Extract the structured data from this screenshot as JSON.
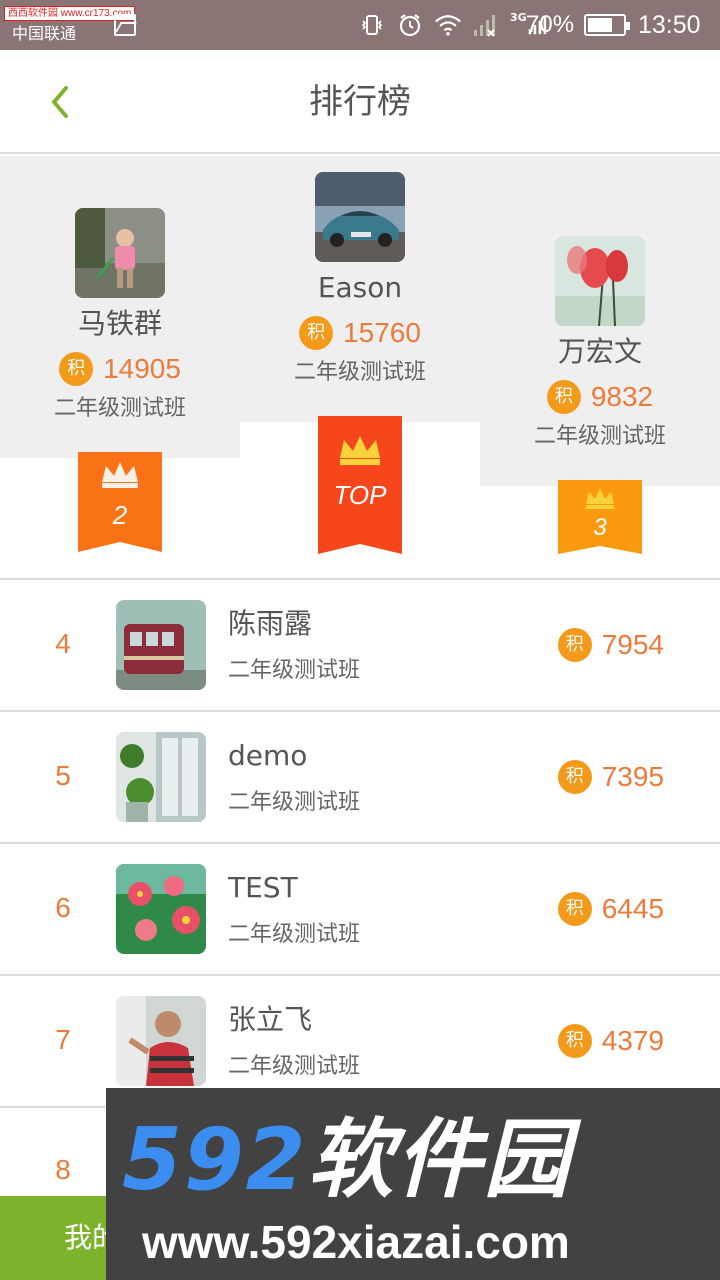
{
  "status_bar": {
    "watermark": "西西软件园 www.cr173.com",
    "carrier": "中国联通",
    "network": "3G",
    "battery": "70%",
    "time": "13:50"
  },
  "header": {
    "title": "排行榜"
  },
  "score_icon_label": "积",
  "podium": [
    {
      "rank_label": "2",
      "name": "马铁群",
      "score": "14905",
      "class_name": "二年级测试班"
    },
    {
      "rank_label": "TOP",
      "name": "Eason",
      "score": "15760",
      "class_name": "二年级测试班"
    },
    {
      "rank_label": "3",
      "name": "万宏文",
      "score": "9832",
      "class_name": "二年级测试班"
    }
  ],
  "ranking": [
    {
      "rank": "4",
      "name": "陈雨露",
      "class_name": "二年级测试班",
      "score": "7954"
    },
    {
      "rank": "5",
      "name": "demo",
      "class_name": "二年级测试班",
      "score": "7395"
    },
    {
      "rank": "6",
      "name": "TEST",
      "class_name": "二年级测试班",
      "score": "6445"
    },
    {
      "rank": "7",
      "name": "张立飞",
      "class_name": "二年级测试班",
      "score": "4379"
    },
    {
      "rank": "8"
    }
  ],
  "bottom_bar": {
    "label": "我的"
  },
  "watermark_banner": {
    "numbers": "592",
    "chinese": "软件园",
    "url": "www.592xiazai.com"
  },
  "colors": {
    "accent_green": "#7cb32a",
    "score_orange": "#ea7b3a",
    "badge_orange": "#f39a1b",
    "ribbon_top": "#f5461c",
    "ribbon_second": "#f97316",
    "ribbon_third": "#fb9a0e"
  }
}
